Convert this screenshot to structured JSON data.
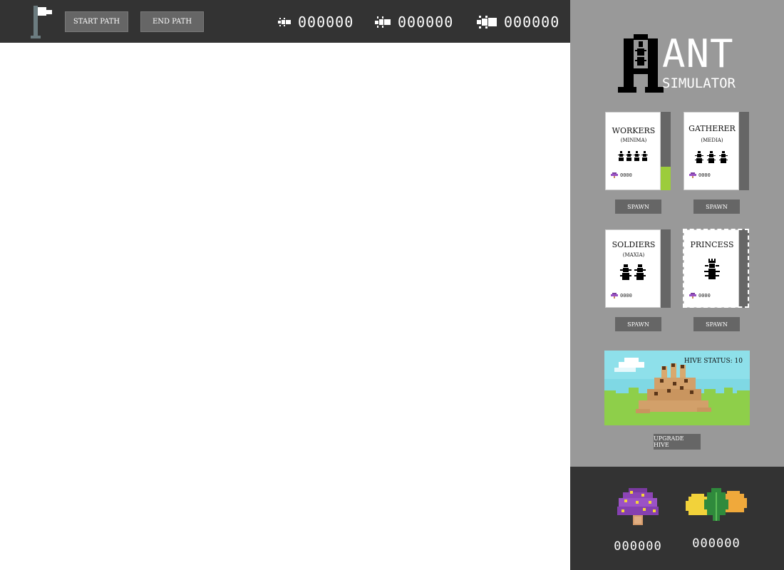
{
  "toolbar": {
    "start_path_label": "START PATH",
    "end_path_label": "END PATH",
    "counters": [
      {
        "icon": "worker-ant-icon",
        "value": "000000"
      },
      {
        "icon": "gatherer-ant-icon",
        "value": "000000"
      },
      {
        "icon": "soldier-ant-icon",
        "value": "000000"
      }
    ]
  },
  "logo": {
    "big_letter": "A",
    "word": "ANT",
    "subtitle": "SIMULATOR"
  },
  "units": [
    {
      "name": "WORKERS",
      "sub": "(MINIMA)",
      "cost": "0000",
      "spawn": "SPAWN",
      "progress": 0.3
    },
    {
      "name": "GATHERER",
      "sub": "(MEDIA)",
      "cost": "0000",
      "spawn": "SPAWN",
      "progress": 0
    },
    {
      "name": "SOLDIERS",
      "sub": "(MAXIA)",
      "cost": "0000",
      "spawn": "SPAWN",
      "progress": 0
    },
    {
      "name": "PRINCESS",
      "sub": "",
      "cost": "0000",
      "spawn": "SPAWN",
      "progress": 0
    }
  ],
  "hive": {
    "status": "HIVE STATUS: 10",
    "upgrade_label": "UPGRADE HIVE"
  },
  "resources": [
    {
      "icon": "mushroom-icon",
      "value": "000000"
    },
    {
      "icon": "leaves-icon",
      "value": "000000"
    }
  ],
  "colors": {
    "topbar": "#333333",
    "sidebar": "#999999",
    "button": "#666666",
    "progress": "#9ccc3b"
  }
}
